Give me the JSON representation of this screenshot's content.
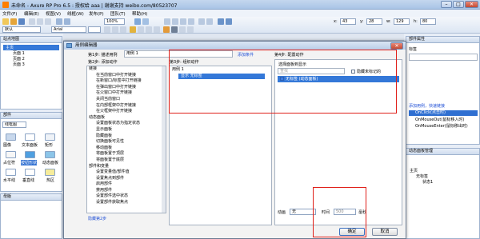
{
  "app": {
    "title": "未命名 - Axure RP Pro 6.5 : 授权给 aaa | 谢谢支持 weibo.com/80523707"
  },
  "menu": [
    "文件(F)",
    "编辑(E)",
    "视图(V)",
    "线框(W)",
    "发布(P)",
    "团队(T)",
    "帮助(H)"
  ],
  "toolbar": {
    "zoom": "100%",
    "font": "Arial",
    "style": "默认",
    "x_label": "x:",
    "x_val": "43",
    "y_label": "y:",
    "y_val": "28",
    "w_label": "w:",
    "w_val": "129",
    "h_label": "h:",
    "h_val": "80"
  },
  "sitemap": {
    "header": "站点地图",
    "root": "主页",
    "pages": [
      "页面 1",
      "页面 2",
      "页面 3"
    ]
  },
  "widgets": {
    "header": "部件",
    "library": "线框图",
    "items": [
      "图像",
      "文本面板",
      "矩形",
      "占位符",
      "按钮形状",
      "动态面板",
      "水平线",
      "垂直线",
      "热区"
    ]
  },
  "masters": {
    "header": "母版"
  },
  "props": {
    "header": "部件属性",
    "tab": "标签",
    "tip": "添加用例，快速链接",
    "events": [
      "OnClick(点击时)",
      "OnMouseOut(鼠标移入时)",
      "OnMouseEnter(鼠标移出时)"
    ]
  },
  "dynpanel": {
    "header": "动态面板管理",
    "root": "主页",
    "panel": "无标签",
    "state": "状态1"
  },
  "dialog": {
    "title": "用例编辑器",
    "step1_label": "第1步: 描述用例",
    "step1_value": "用例 1",
    "add_condition": "添加条件",
    "step2_label": "第2步: 添加动作",
    "step3_label": "第3步: 组织动作",
    "step4_label": "第4步: 配置动作",
    "hide_step2": "隐藏第2步",
    "actions": [
      {
        "text": "链接",
        "kind": "group"
      },
      {
        "text": "在当前窗口中打开链接",
        "kind": "item"
      },
      {
        "text": "在新窗口/标签中打开链接",
        "kind": "item"
      },
      {
        "text": "在弹出窗口中打开链接",
        "kind": "item"
      },
      {
        "text": "在父窗口中打开链接",
        "kind": "item"
      },
      {
        "text": "关闭当前窗口",
        "kind": "item"
      },
      {
        "text": "在内部框架中打开链接",
        "kind": "item"
      },
      {
        "text": "在父框架中打开链接",
        "kind": "item"
      },
      {
        "text": "动态面板",
        "kind": "group"
      },
      {
        "text": "设置面板状态为指定状态",
        "kind": "item"
      },
      {
        "text": "显示面板",
        "kind": "item"
      },
      {
        "text": "隐藏面板",
        "kind": "item"
      },
      {
        "text": "切换面板可见性",
        "kind": "item"
      },
      {
        "text": "移动面板",
        "kind": "item"
      },
      {
        "text": "将面板置于顶层",
        "kind": "item"
      },
      {
        "text": "将面板置于底层",
        "kind": "item"
      },
      {
        "text": "部件和变量",
        "kind": "group"
      },
      {
        "text": "设置变量值/部件值",
        "kind": "item"
      },
      {
        "text": "设置焦点到部件",
        "kind": "item"
      },
      {
        "text": "启用部件",
        "kind": "item"
      },
      {
        "text": "禁用部件",
        "kind": "item"
      },
      {
        "text": "设置部件选中状态",
        "kind": "item"
      },
      {
        "text": "设置部件获取焦点",
        "kind": "item"
      }
    ],
    "organize": {
      "case": "用例 1",
      "action": "显示 无标签"
    },
    "config": {
      "header": "选择面板到显示",
      "search_placeholder": "查找",
      "hide_unnamed": "隐藏未标记的",
      "panel_item": "无标签 (动态面板)",
      "anim_label": "动画",
      "anim_value": "无",
      "time_label": "时间",
      "time_value": "500",
      "ms": "毫秒"
    },
    "ok": "确定",
    "cancel": "取消"
  }
}
